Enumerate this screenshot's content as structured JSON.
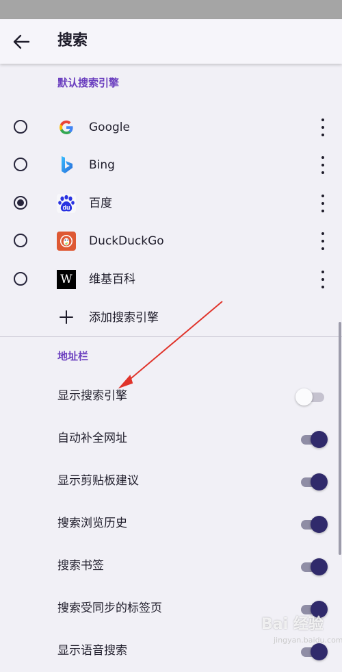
{
  "header": {
    "title": "搜索"
  },
  "sections": {
    "default_engine": "默认搜索引擎",
    "address_bar": "地址栏"
  },
  "engines": [
    {
      "label": "Google",
      "checked": false
    },
    {
      "label": "Bing",
      "checked": false
    },
    {
      "label": "百度",
      "checked": true
    },
    {
      "label": "DuckDuckGo",
      "checked": false
    },
    {
      "label": "维基百科",
      "checked": false
    }
  ],
  "add_engine": {
    "label": "添加搜索引擎"
  },
  "toggles": [
    {
      "label": "显示搜索引擎",
      "on": false
    },
    {
      "label": "自动补全网址",
      "on": true
    },
    {
      "label": "显示剪贴板建议",
      "on": true
    },
    {
      "label": "搜索浏览历史",
      "on": true
    },
    {
      "label": "搜索书签",
      "on": true
    },
    {
      "label": "搜索受同步的标签页",
      "on": true
    },
    {
      "label": "显示语音搜索",
      "on": true
    }
  ],
  "icons": {
    "google": "google-logo",
    "bing": "bing-logo",
    "baidu": "baidu-logo",
    "baidu_text": "du",
    "duckduckgo": "duckduckgo-logo",
    "wikipedia": "wikipedia-logo",
    "wikipedia_text": "W"
  },
  "watermark": {
    "text": "Bai 经验",
    "sub": "jingyan.baidu.com"
  },
  "colors": {
    "accent": "#6b3fbf",
    "switch_on": "#302a6b",
    "background": "#f1f0f6"
  }
}
